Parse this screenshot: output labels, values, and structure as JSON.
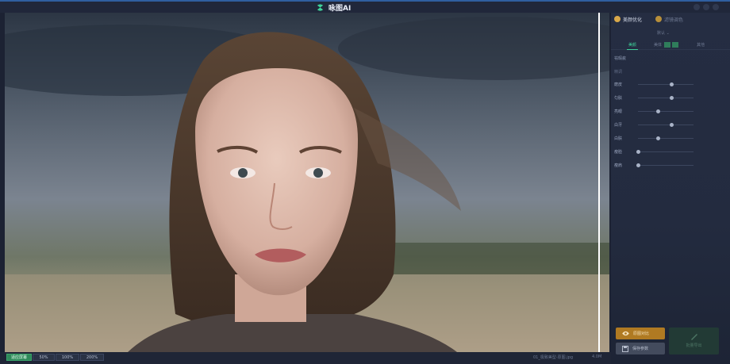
{
  "app": {
    "title": "咏图AI"
  },
  "status_bar": {
    "zoom_options": [
      "适应屏幕",
      "50%",
      "100%",
      "200%"
    ],
    "active_zoom_index": 0,
    "file_name": "01_极致美型-原图.jpg",
    "file_size": "4.0M"
  },
  "panel": {
    "tabs": [
      {
        "label": "美颜优化",
        "icon": "face-icon",
        "active": true
      },
      {
        "label": "滤镜调色",
        "icon": "brush-icon",
        "active": false
      }
    ],
    "preset_label": "默认 ⌄",
    "subtabs": [
      {
        "label": "美颜",
        "active": true
      },
      {
        "label": "美体",
        "active": false
      },
      {
        "label": "其他",
        "active": false
      }
    ],
    "sections": [
      {
        "label": "祛瑕疵",
        "value": ""
      },
      {
        "label": "精调",
        "value": ""
      }
    ],
    "sliders": [
      {
        "label": "磨皮",
        "value": 0.6
      },
      {
        "label": "匀肤",
        "value": 0.6
      },
      {
        "label": "亮眼",
        "value": 0.35
      },
      {
        "label": "白牙",
        "value": 0.6
      },
      {
        "label": "白肤",
        "value": 0.35
      },
      {
        "label": "瘦脸",
        "value": 0.0
      },
      {
        "label": "瘦肩",
        "value": 0.0
      }
    ],
    "compare_label": "原图对比",
    "save_label": "保存参数",
    "export_label": "批量导出"
  },
  "colors": {
    "accent": "#3fd29a",
    "compare": "#b07a22",
    "panel": "#232b3f"
  }
}
